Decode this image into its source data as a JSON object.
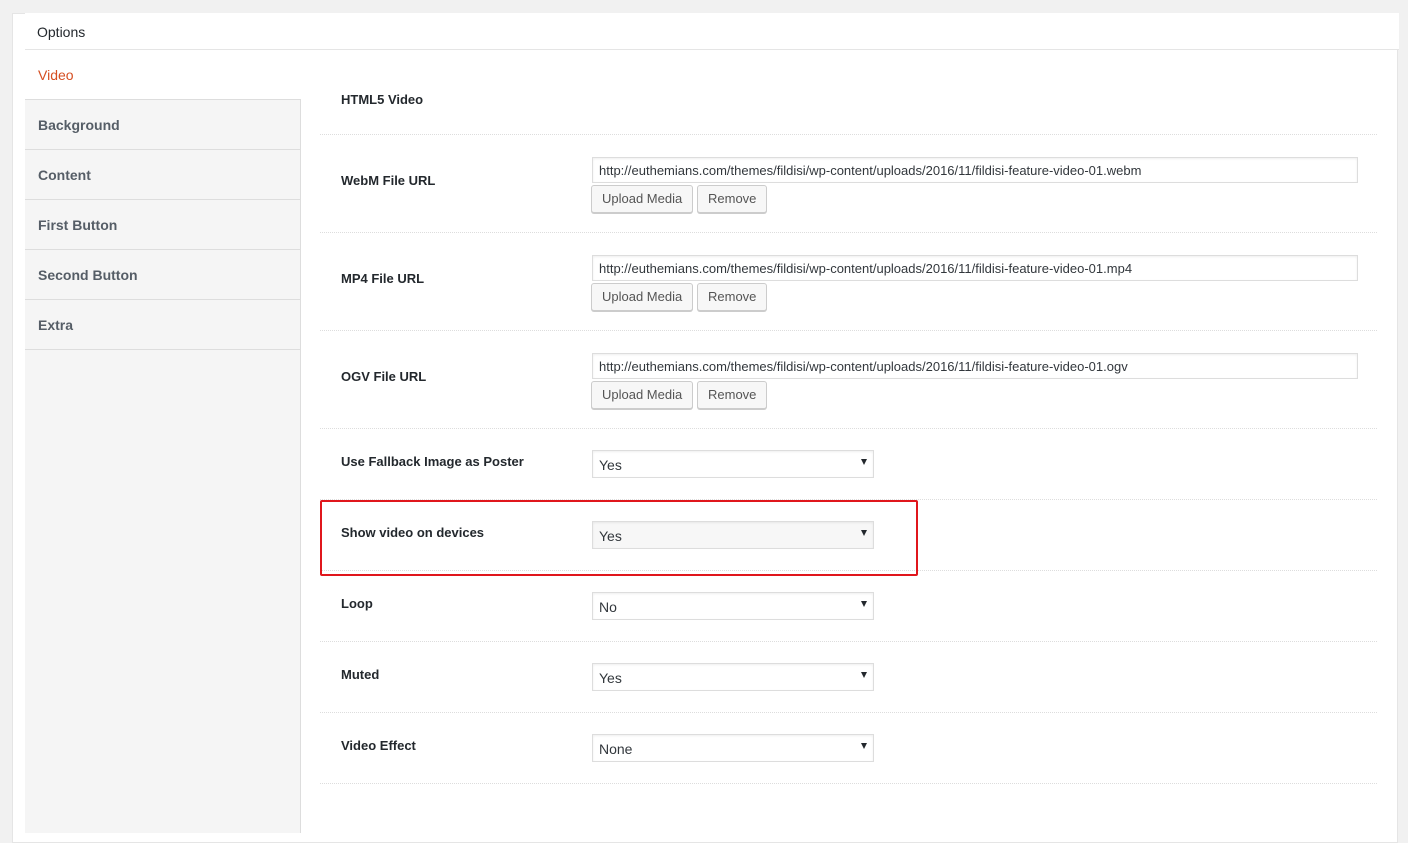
{
  "panel": {
    "title": "Options"
  },
  "sidebar": {
    "items": [
      {
        "label": "Video",
        "active": true
      },
      {
        "label": "Background",
        "active": false
      },
      {
        "label": "Content",
        "active": false
      },
      {
        "label": "First Button",
        "active": false
      },
      {
        "label": "Second Button",
        "active": false
      },
      {
        "label": "Extra",
        "active": false
      }
    ]
  },
  "section": {
    "heading": "HTML5 Video"
  },
  "fields": {
    "webm": {
      "label": "WebM File URL",
      "value": "http://euthemians.com/themes/fildisi/wp-content/uploads/2016/11/fildisi-feature-video-01.webm",
      "upload_label": "Upload Media",
      "remove_label": "Remove"
    },
    "mp4": {
      "label": "MP4 File URL",
      "value": "http://euthemians.com/themes/fildisi/wp-content/uploads/2016/11/fildisi-feature-video-01.mp4",
      "upload_label": "Upload Media",
      "remove_label": "Remove"
    },
    "ogv": {
      "label": "OGV File URL",
      "value": "http://euthemians.com/themes/fildisi/wp-content/uploads/2016/11/fildisi-feature-video-01.ogv",
      "upload_label": "Upload Media",
      "remove_label": "Remove"
    },
    "fallback_poster": {
      "label": "Use Fallback Image as Poster",
      "value": "Yes"
    },
    "show_on_devices": {
      "label": "Show video on devices",
      "value": "Yes"
    },
    "loop": {
      "label": "Loop",
      "value": "No"
    },
    "muted": {
      "label": "Muted",
      "value": "Yes"
    },
    "video_effect": {
      "label": "Video Effect",
      "value": "None"
    }
  },
  "colors": {
    "active_tab": "#d54e21",
    "highlight_border": "#e0161c"
  }
}
